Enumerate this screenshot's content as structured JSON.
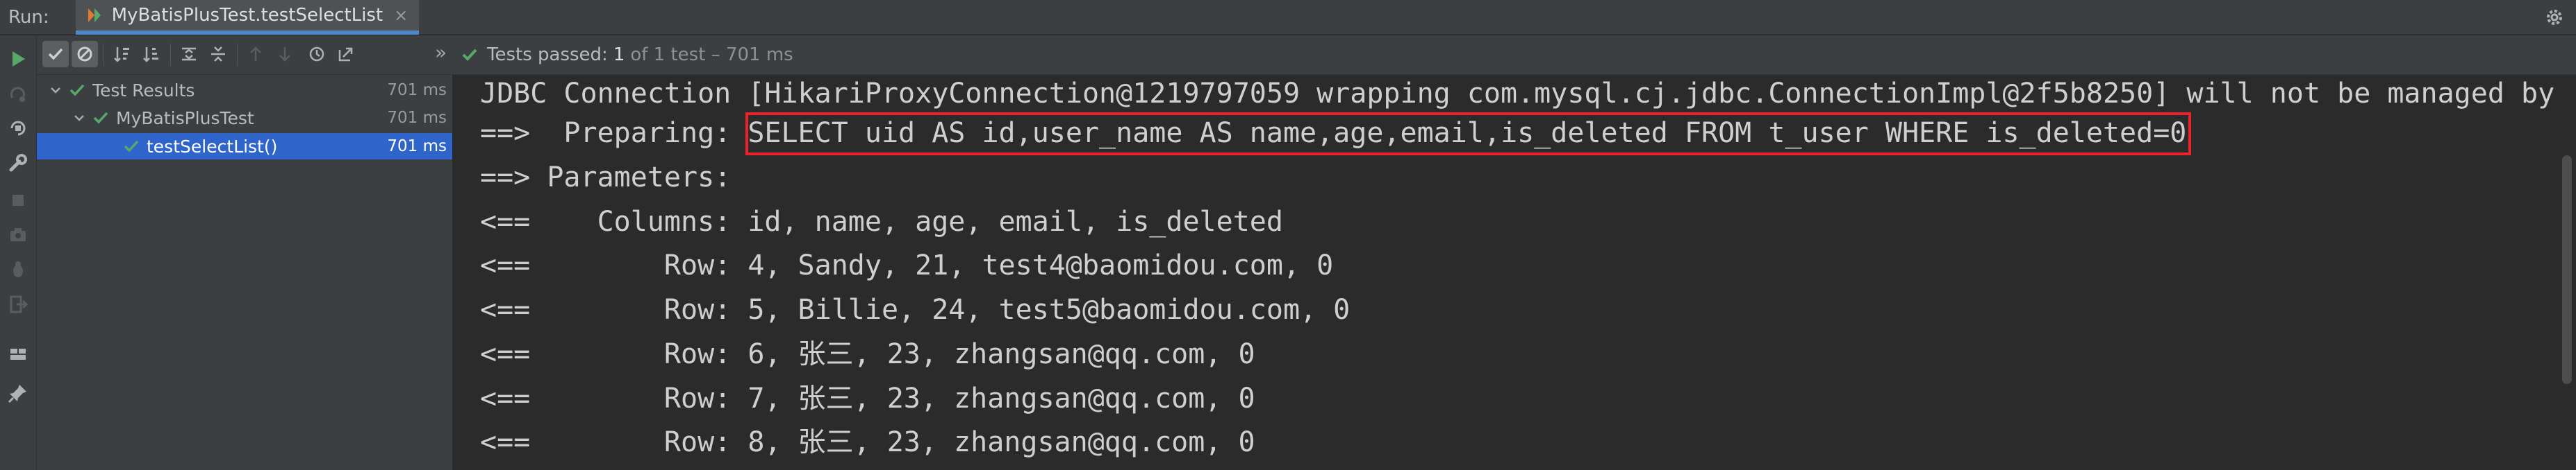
{
  "header": {
    "run_label": "Run:",
    "tab_title": "MyBatisPlusTest.testSelectList",
    "tab_close": "×"
  },
  "toolbar": {
    "more_label": "»",
    "status_prefix": "Tests passed:",
    "status_count": "1",
    "status_suffix": "of 1 test – 701 ms"
  },
  "tree": {
    "items": [
      {
        "label": "Test Results",
        "duration": "701 ms"
      },
      {
        "label": "MyBatisPlusTest",
        "duration": "701 ms"
      },
      {
        "label": "testSelectList()",
        "duration": "701 ms"
      }
    ]
  },
  "console": {
    "lines": [
      "JDBC Connection [HikariProxyConnection@1219797059 wrapping com.mysql.cj.jdbc.ConnectionImpl@2f5b8250] will not be managed by",
      "==>  Preparing: SELECT uid AS id,user_name AS name,age,email,is_deleted FROM t_user WHERE is_deleted=0",
      "==> Parameters: ",
      "<==    Columns: id, name, age, email, is_deleted",
      "<==        Row: 4, Sandy, 21, test4@baomidou.com, 0",
      "<==        Row: 5, Billie, 24, test5@baomidou.com, 0",
      "<==        Row: 6, 张三, 23, zhangsan@qq.com, 0",
      "<==        Row: 7, 张三, 23, zhangsan@qq.com, 0",
      "<==        Row: 8, 张三, 23, zhangsan@qq.com, 0"
    ]
  },
  "colors": {
    "pass_green": "#59a869",
    "highlight_red": "#e8232b",
    "selection_blue": "#2f65ca"
  },
  "icons": {
    "left_bar": [
      "run-icon",
      "rerun-failed-icon",
      "toggle-auto-test-icon",
      "wrench-icon",
      "stop-icon",
      "camera-icon",
      "debug-icon",
      "exit-icon",
      "layout-icon",
      "pin-icon"
    ],
    "toolbar": [
      "show-passed-icon",
      "show-ignored-icon",
      "sort-alpha-icon",
      "sort-duration-icon",
      "expand-all-icon",
      "collapse-all-icon",
      "prev-failed-icon",
      "next-failed-icon",
      "history-icon",
      "export-icon"
    ]
  }
}
